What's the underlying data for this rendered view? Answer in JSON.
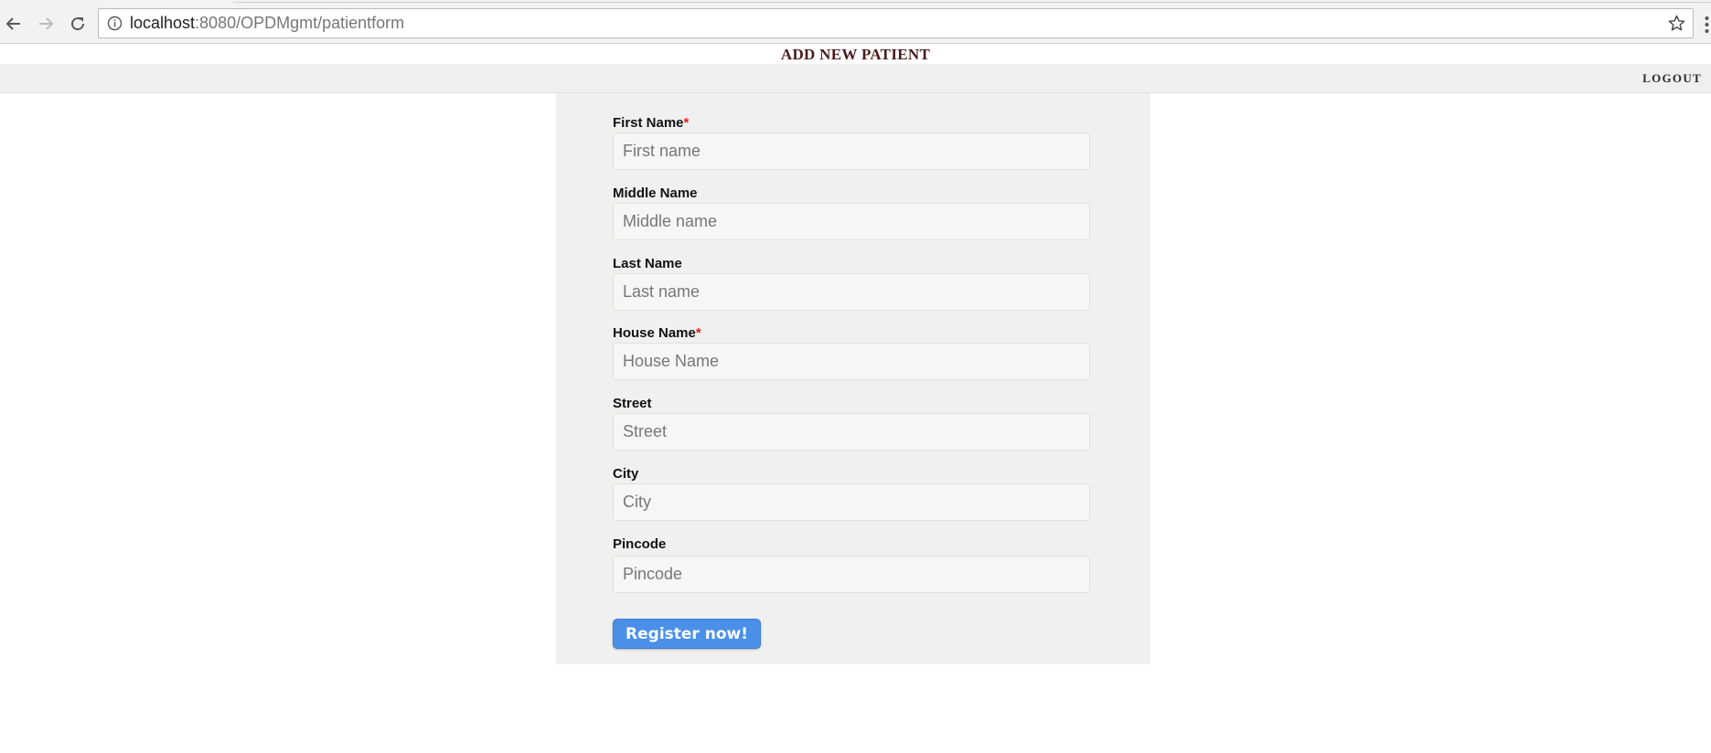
{
  "browser": {
    "url_host": "localhost",
    "url_rest": ":8080/OPDMgmt/patientform",
    "icons": {
      "back": "back-arrow-icon",
      "forward": "forward-arrow-icon",
      "reload": "reload-icon",
      "info": "info-icon",
      "bookmark": "star-icon",
      "menu": "menu-dots-icon"
    }
  },
  "page": {
    "title": "ADD NEW PATIENT",
    "logout_label": "LOGOUT"
  },
  "form": {
    "required_marker": "*",
    "fields": [
      {
        "label": "First Name",
        "placeholder": "First name",
        "value": "",
        "required": true
      },
      {
        "label": "Middle Name",
        "placeholder": "Middle name",
        "value": "",
        "required": false
      },
      {
        "label": "Last Name",
        "placeholder": "Last name",
        "value": "",
        "required": false
      },
      {
        "label": "House Name",
        "placeholder": "House Name",
        "value": "",
        "required": true
      },
      {
        "label": "Street",
        "placeholder": "Street",
        "value": "",
        "required": false
      },
      {
        "label": "City",
        "placeholder": "City",
        "value": "",
        "required": false
      },
      {
        "label": "Pincode",
        "placeholder": "Pincode",
        "value": "",
        "required": false
      }
    ],
    "submit_label": "Register now!"
  },
  "colors": {
    "title": "#4a1c1c",
    "required": "#e0201a",
    "button": "#4a90e8",
    "panel": "#f0f0f0",
    "navbar": "#efefef"
  }
}
